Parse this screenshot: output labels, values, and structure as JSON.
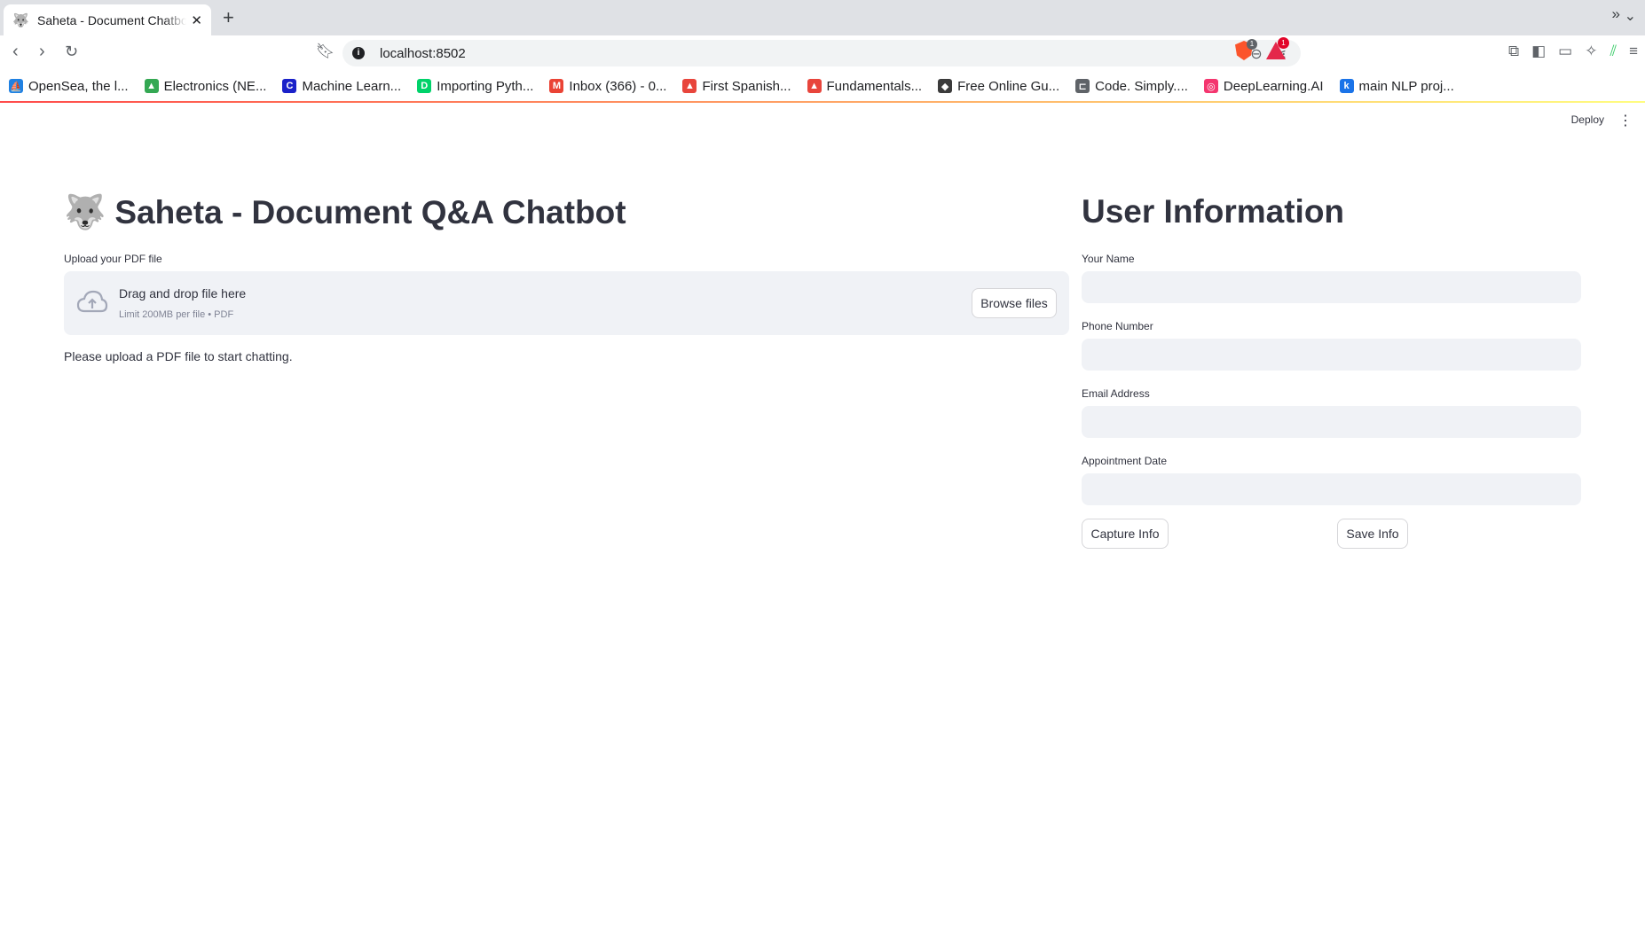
{
  "browser": {
    "tab_title": "Saheta - Document Chatbot",
    "tab_favicon": "🐺",
    "url": "localhost:8502",
    "brave_badge": "1",
    "rewards_badge": "1",
    "bookmarks": [
      {
        "label": "OpenSea, the l...",
        "color": "#2081e2",
        "glyph": "⛵"
      },
      {
        "label": "Electronics (NE...",
        "color": "#34a853",
        "glyph": "▲"
      },
      {
        "label": "Machine Learn...",
        "color": "#1a21c9",
        "glyph": "C"
      },
      {
        "label": "Importing Pyth...",
        "color": "#00d26a",
        "glyph": "D"
      },
      {
        "label": "Inbox (366) - 0...",
        "color": "#ea4335",
        "glyph": "M"
      },
      {
        "label": "First Spanish...",
        "color": "#e8453c",
        "glyph": "▲"
      },
      {
        "label": "Fundamentals...",
        "color": "#e8453c",
        "glyph": "▲"
      },
      {
        "label": "Free Online Gu...",
        "color": "#3b3b3b",
        "glyph": "◆"
      },
      {
        "label": "Code. Simply....",
        "color": "#5f6368",
        "glyph": "⊏"
      },
      {
        "label": "DeepLearning.AI",
        "color": "#f4366f",
        "glyph": "◎"
      },
      {
        "label": "main NLP proj...",
        "color": "#1a73e8",
        "glyph": "k"
      }
    ]
  },
  "app": {
    "deploy_label": "Deploy",
    "title_emoji": "🐺",
    "title": "Saheta - Document Q&A Chatbot",
    "uploader": {
      "label": "Upload your PDF file",
      "main_text": "Drag and drop file here",
      "sub_text": "Limit 200MB per file • PDF",
      "browse_label": "Browse files"
    },
    "info_message": "Please upload a PDF file to start chatting.",
    "user_info": {
      "title": "User Information",
      "fields": {
        "name_label": "Your Name",
        "phone_label": "Phone Number",
        "email_label": "Email Address",
        "date_label": "Appointment Date",
        "name_value": "",
        "phone_value": "",
        "email_value": "",
        "date_value": ""
      },
      "capture_label": "Capture Info",
      "save_label": "Save Info"
    }
  }
}
